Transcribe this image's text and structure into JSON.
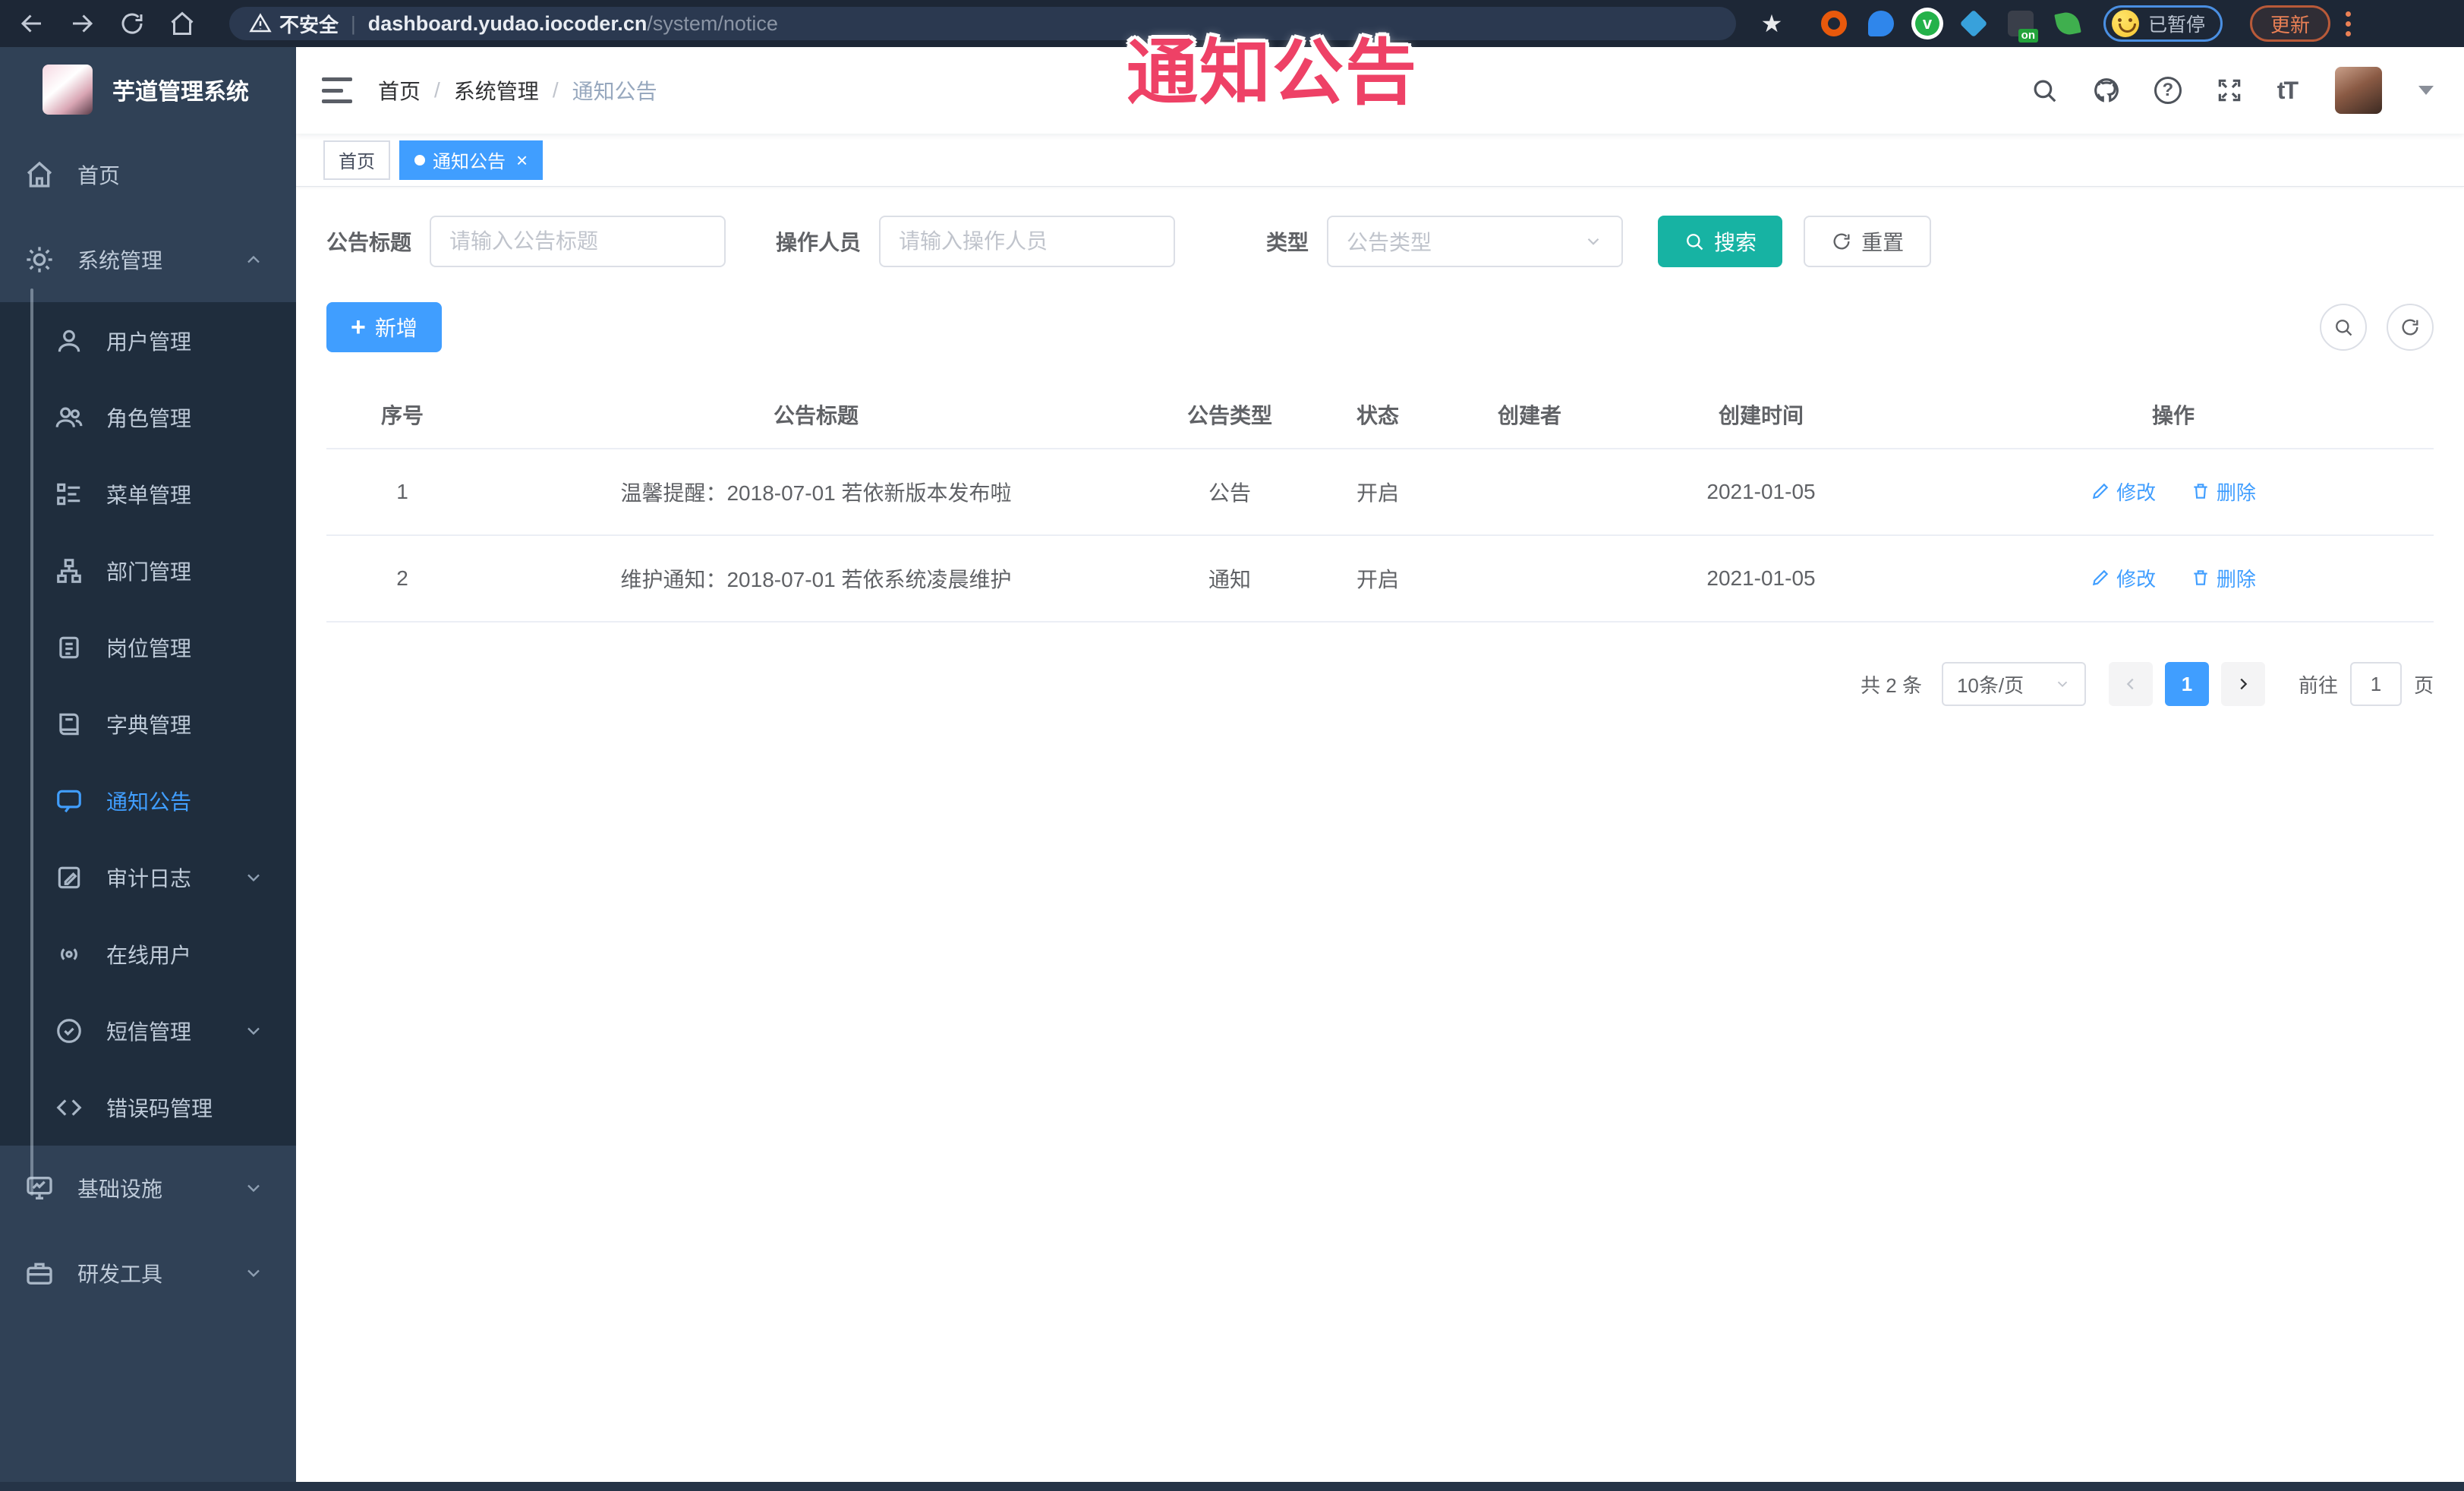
{
  "browser": {
    "security_label": "不安全",
    "url_host": "dashboard.yudao.iocoder.cn",
    "url_path": "/system/notice",
    "url_separator": "|",
    "extension_on_badge": "on",
    "extension_green_glyph": "v",
    "paused_label": "已暂停",
    "update_label": "更新",
    "star_glyph": "★"
  },
  "watermark": {
    "text": "通知公告",
    "color": "#ee4166"
  },
  "sidebar": {
    "title": "芋道管理系统",
    "items": [
      {
        "label": "首页",
        "level": "root"
      },
      {
        "label": "系统管理",
        "level": "root",
        "chevron": "up"
      },
      {
        "label": "用户管理",
        "level": "sub"
      },
      {
        "label": "角色管理",
        "level": "sub"
      },
      {
        "label": "菜单管理",
        "level": "sub"
      },
      {
        "label": "部门管理",
        "level": "sub"
      },
      {
        "label": "岗位管理",
        "level": "sub"
      },
      {
        "label": "字典管理",
        "level": "sub"
      },
      {
        "label": "通知公告",
        "level": "sub",
        "active": true
      },
      {
        "label": "审计日志",
        "level": "sub",
        "chevron": "down"
      },
      {
        "label": "在线用户",
        "level": "sub"
      },
      {
        "label": "短信管理",
        "level": "sub",
        "chevron": "down"
      },
      {
        "label": "错误码管理",
        "level": "sub"
      },
      {
        "label": "基础设施",
        "level": "root",
        "chevron": "down"
      },
      {
        "label": "研发工具",
        "level": "root",
        "chevron": "down"
      }
    ]
  },
  "navbar": {
    "breadcrumb": [
      "首页",
      "系统管理",
      "通知公告"
    ],
    "separator": "/",
    "help_glyph": "?",
    "font_size_glyph": "tT"
  },
  "tags": {
    "items": [
      {
        "label": "首页"
      },
      {
        "label": "通知公告"
      }
    ],
    "close_glyph": "×"
  },
  "filter": {
    "title_label": "公告标题",
    "title_placeholder": "请输入公告标题",
    "operator_label": "操作人员",
    "operator_placeholder": "请输入操作人员",
    "type_label": "类型",
    "type_placeholder": "公告类型",
    "search_label": "搜索",
    "reset_label": "重置"
  },
  "toolbar": {
    "add_label": "新增",
    "plus_glyph": "+"
  },
  "table": {
    "headers": [
      "序号",
      "公告标题",
      "公告类型",
      "状态",
      "创建者",
      "创建时间",
      "操作"
    ],
    "rows": [
      {
        "no": "1",
        "title": "温馨提醒：2018-07-01 若依新版本发布啦",
        "type": "公告",
        "status": "开启",
        "creator": "",
        "created": "2021-01-05"
      },
      {
        "no": "2",
        "title": "维护通知：2018-07-01 若依系统凌晨维护",
        "type": "通知",
        "status": "开启",
        "creator": "",
        "created": "2021-01-05"
      }
    ],
    "edit_label": "修改",
    "delete_label": "删除"
  },
  "pagination": {
    "total": "共 2 条",
    "page_size": "10条/页",
    "current": "1",
    "goto_label": "前往",
    "goto_value": "1",
    "page_unit": "页"
  },
  "colors": {
    "primary": "#409eff",
    "search_button": "#17b3a3",
    "sidebar_bg": "#304156",
    "submenu_bg": "#1f2d3d",
    "chrome_bar": "#1d2736",
    "watermark": "#ee4166"
  }
}
